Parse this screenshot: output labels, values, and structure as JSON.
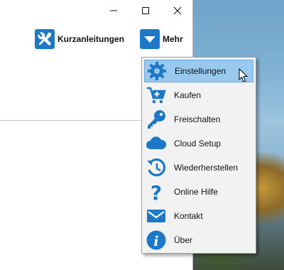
{
  "window": {
    "controls": {
      "minimize": "minimize",
      "maximize": "maximize",
      "close": "close"
    }
  },
  "toolbar": {
    "kurzanleitungen_label": "Kurzanleitungen",
    "mehr_label": "Mehr"
  },
  "menu": {
    "items": [
      {
        "label": "Einstellungen",
        "icon": "gear-icon"
      },
      {
        "label": "Kaufen",
        "icon": "cart-icon"
      },
      {
        "label": "Freischalten",
        "icon": "key-icon"
      },
      {
        "label": "Cloud Setup",
        "icon": "cloud-icon"
      },
      {
        "label": "Wiederherstellen",
        "icon": "history-icon"
      },
      {
        "label": "Online Hilfe",
        "icon": "question-icon"
      },
      {
        "label": "Kontakt",
        "icon": "mail-icon"
      },
      {
        "label": "Über",
        "icon": "info-icon"
      }
    ],
    "hovered_item": "Einstellungen"
  },
  "colors": {
    "icon_blue": "#1e78c8",
    "menu_hover": "#99c9ef",
    "menu_background": "#f2f2f2"
  }
}
